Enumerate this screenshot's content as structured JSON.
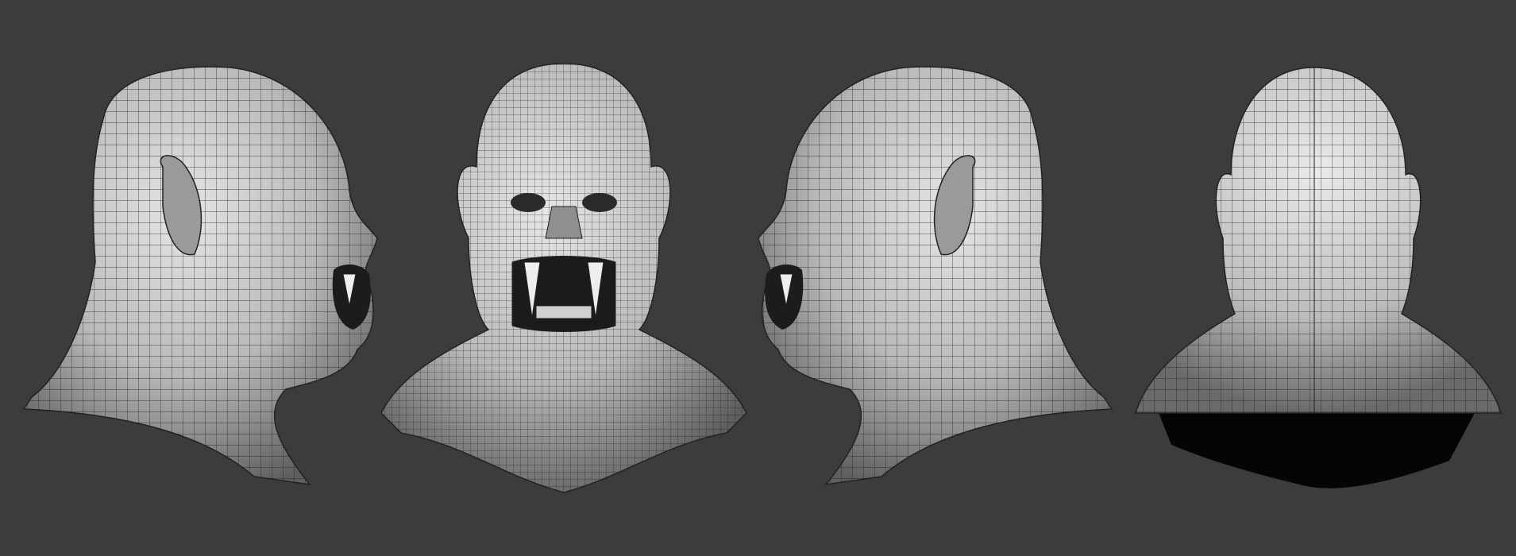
{
  "scene": {
    "background_color": "#3c3c3c",
    "mesh_fill_light": "#d9d9d9",
    "mesh_fill_dark": "#5a5a5a",
    "wire_color": "#1a1a1a"
  },
  "views": [
    {
      "name": "right-profile",
      "facing": "right"
    },
    {
      "name": "front",
      "facing": "front"
    },
    {
      "name": "left-profile",
      "facing": "left"
    },
    {
      "name": "back",
      "facing": "back"
    }
  ]
}
